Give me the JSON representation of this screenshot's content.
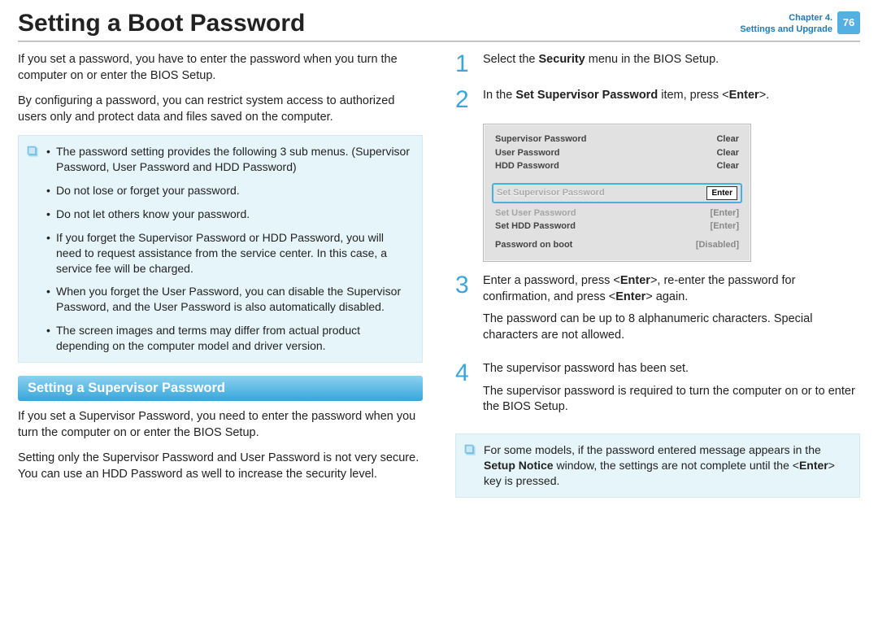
{
  "header": {
    "title": "Setting a Boot Password",
    "chapter_line1": "Chapter 4.",
    "chapter_line2": "Settings and Upgrade",
    "page_number": "76"
  },
  "leftCol": {
    "intro1": "If you set a password, you have to enter the password when you turn the computer on or enter the BIOS Setup.",
    "intro2": "By configuring a password, you can restrict system access to authorized users only and protect data and files saved on the computer.",
    "noteItems": [
      "The password setting provides the following 3 sub menus. (Supervisor Password, User Password and HDD Password)",
      "Do not lose or forget your password.",
      "Do not let others know your password.",
      "If you forget the Supervisor Password or HDD Password, you will need to request assistance from the service center. In this case, a service fee will be charged.",
      "When you forget the User Password, you can disable the Supervisor Password, and the User Password is also automatically disabled.",
      "The screen images and terms may differ from actual product depending on the computer model and driver version."
    ],
    "subheading": "Setting a Supervisor Password",
    "sub1": "If you set a Supervisor Password, you need to enter the password when you turn the computer on or enter the BIOS Setup.",
    "sub2": "Setting only the Supervisor Password and User Password is not very secure. You can use an HDD Password as well to increase the security level."
  },
  "rightCol": {
    "steps": {
      "s1_num": "1",
      "s1_a": "Select the ",
      "s1_b": "Security",
      "s1_c": " menu in the BIOS Setup.",
      "s2_num": "2",
      "s2_a": "In the ",
      "s2_b": "Set Supervisor Password",
      "s2_c": " item, press <",
      "s2_d": "Enter",
      "s2_e": ">.",
      "s3_num": "3",
      "s3_a": "Enter a password, press <",
      "s3_b": "Enter",
      "s3_c": ">, re-enter the password for confirmation, and press <",
      "s3_d": "Enter",
      "s3_e": "> again.",
      "s3_p2": "The password can be up to 8 alphanumeric characters. Special characters are not allowed.",
      "s4_num": "4",
      "s4_p1": "The supervisor password has been set.",
      "s4_p2": "The supervisor password is required to turn the computer on or to enter the BIOS Setup."
    },
    "note2_a": "For some models, if the password entered message appears in the ",
    "note2_b": "Setup Notice",
    "note2_c": " window, the settings are not complete until the <",
    "note2_d": "Enter",
    "note2_e": "> key is pressed."
  },
  "bios": {
    "rows": [
      {
        "label": "Supervisor Password",
        "value": "Clear"
      },
      {
        "label": "User Password",
        "value": "Clear"
      },
      {
        "label": "HDD Password",
        "value": "Clear"
      }
    ],
    "hl": {
      "label": "Set Supervisor Password",
      "value": "Enter"
    },
    "rows2": [
      {
        "label": "Set User Password",
        "value": "[Enter]"
      },
      {
        "label": "Set HDD Password",
        "value": "[Enter]"
      }
    ],
    "boot": {
      "label": "Password on boot",
      "value": "[Disabled]"
    }
  }
}
